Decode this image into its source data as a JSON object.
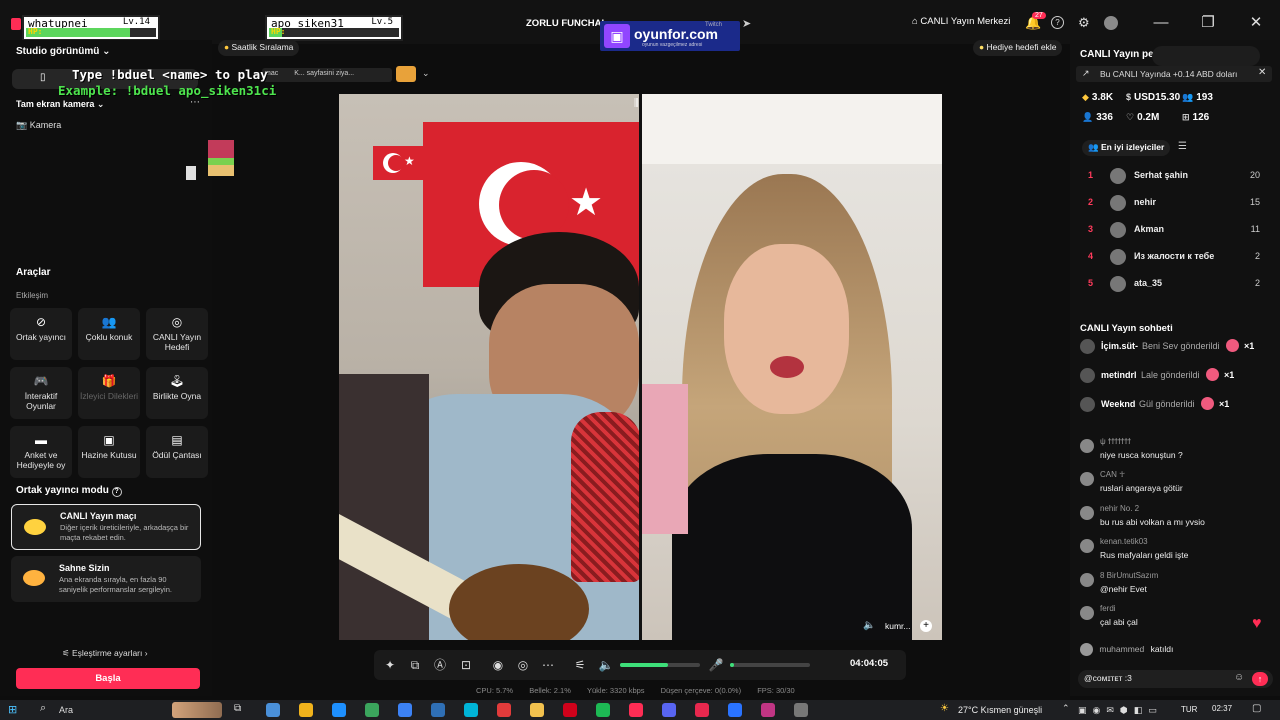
{
  "overlay": {
    "player1": {
      "name": "whatupnei",
      "level": "Lv.14",
      "hp_label": "HP:",
      "hp": 0.8
    },
    "player2": {
      "name": "apo_siken31",
      "level": "Lv.5",
      "hp_label": "HP:",
      "hp": 0.1
    },
    "instruction": "Type !bduel <name> to play",
    "example": "Example: !bduel apo_siken31ci",
    "chip_text": "mac",
    "chip_text2": "K... sayfasini ziya..."
  },
  "header": {
    "battle_title": "ZORLU FUNCHAL",
    "sponsor_brand": "oyunfor.com",
    "sponsor_tagline": "oyunun vazgeçilmez adresi",
    "sponsor_badge": "Twitch",
    "live_center": "CANLI Yayın Merkezi",
    "notif_count": "27",
    "hourly_ranking": "Saatlik Sıralama",
    "add_gift_goal": "Hediye hedefi ekle"
  },
  "left": {
    "studio_view": "Studio görünümü",
    "fullscreen_camera": "Tam ekran kamera",
    "camera": "Kamera",
    "tools_title": "Araçlar",
    "interaction": "Etkileşim",
    "tools": [
      {
        "icon": "link-icon",
        "glyph": "⊘",
        "label": "Ortak yayıncı",
        "enabled": true
      },
      {
        "icon": "multi-guest-icon",
        "glyph": "👥",
        "label": "Çoklu konuk",
        "enabled": true
      },
      {
        "icon": "live-goal-icon",
        "glyph": "◎",
        "label": "CANLI Yayın Hedefi",
        "enabled": true
      },
      {
        "icon": "game-controller-icon",
        "glyph": "🎮",
        "label": "İnteraktif Oyunlar",
        "enabled": true
      },
      {
        "icon": "viewer-request-icon",
        "glyph": "🎁",
        "label": "İzleyici Dilekleri",
        "enabled": false
      },
      {
        "icon": "play-together-icon",
        "glyph": "🕹",
        "label": "Birlikte Oyna",
        "enabled": true
      },
      {
        "icon": "poll-icon",
        "glyph": "▬",
        "label": "Anket ve Hediyeyle oy",
        "enabled": true
      },
      {
        "icon": "treasure-box-icon",
        "glyph": "▣",
        "label": "Hazine Kutusu",
        "enabled": true
      },
      {
        "icon": "reward-bag-icon",
        "glyph": "▤",
        "label": "Ödül Çantası",
        "enabled": true
      }
    ],
    "cohost_mode_title": "Ortak yayıncı modu",
    "live_match_title": "CANLI Yayın maçı",
    "live_match_desc": "Diğer içerik üreticileriyle, arkadaşça bir maçta rekabet edin.",
    "stage_title": "Sahne Sizin",
    "stage_desc": "Ana ekranda sırayla, en fazla 90 saniyelik performanslar sergileyin.",
    "match_settings": "Eşleştirme ayarları",
    "start_button": "Başla"
  },
  "video": {
    "right_user": "kumr..."
  },
  "controls": {
    "timer": "04:04:05",
    "volume_level": 0.6,
    "mic_level": 0.05
  },
  "stats_bar": {
    "cpu": "CPU: 5.7%",
    "memory": "Bellek: 2.1%",
    "upload": "Yükle: 3320 kbps",
    "dropped": "Düşen çerçeve: 0(0.0%)",
    "fps": "FPS: 30/30"
  },
  "right": {
    "title": "CANLI Yayın pe",
    "earnings_banner": "Bu CANLI Yayında +0.14 ABD doları",
    "stats": [
      {
        "icon": "diamond-icon",
        "glyph": "◆",
        "value": "3.8K"
      },
      {
        "icon": "dollar-icon",
        "glyph": "$",
        "value": "USD15.30"
      },
      {
        "icon": "people-icon",
        "glyph": "👥",
        "value": "193"
      },
      {
        "icon": "person-icon",
        "glyph": "👤",
        "value": "336"
      },
      {
        "icon": "heart-icon",
        "glyph": "♡",
        "value": "0.2M"
      },
      {
        "icon": "gift-icon",
        "glyph": "⊞",
        "value": "126"
      }
    ],
    "top_viewers_title": "En iyi izleyiciler",
    "ranking": [
      {
        "rank": "1",
        "name": "Serhat şahin",
        "score": "20"
      },
      {
        "rank": "2",
        "name": "nehir",
        "score": "15"
      },
      {
        "rank": "3",
        "name": "Akman",
        "score": "11"
      },
      {
        "rank": "4",
        "name": "Из жалости к тебе",
        "score": "2"
      },
      {
        "rank": "5",
        "name": "ata_35",
        "score": "2"
      }
    ],
    "chat_title": "CANLI Yayın sohbeti",
    "gifts": [
      {
        "user": "İçim.süt-",
        "text": "Beni Sev gönderildi",
        "count": "×1"
      },
      {
        "user": "metindrl",
        "text": "Lale gönderildi",
        "count": "×1"
      },
      {
        "user": "Weeknd",
        "text": "Gül gönderildi",
        "count": "×1"
      }
    ],
    "chat": [
      {
        "user": "ψ ϯϯϯϯϯϯϯ",
        "msg": "niye rusca konuştun ?"
      },
      {
        "user": "CAN ☥",
        "msg": "ruslari angaraya götür"
      },
      {
        "user": "nehir  No. 2",
        "msg": "bu rus abi volkan a mı yvsio"
      },
      {
        "user": "kenan.tetik03",
        "msg": "Rus mafyaları geldi işte"
      },
      {
        "user": "8  BirUmutSazım",
        "msg": "@nehir Evet"
      },
      {
        "user": "ferdi",
        "msg": "çal abi çal"
      }
    ],
    "joined_user": "muhammed",
    "joined_text": "katıldı",
    "input_value": "@cᴏᴍɪᴛᴇᴛ :3"
  },
  "taskbar": {
    "search": "Ara",
    "weather": "27°C  Kısmen güneşli",
    "lang": "TUR",
    "time": "02:37"
  }
}
